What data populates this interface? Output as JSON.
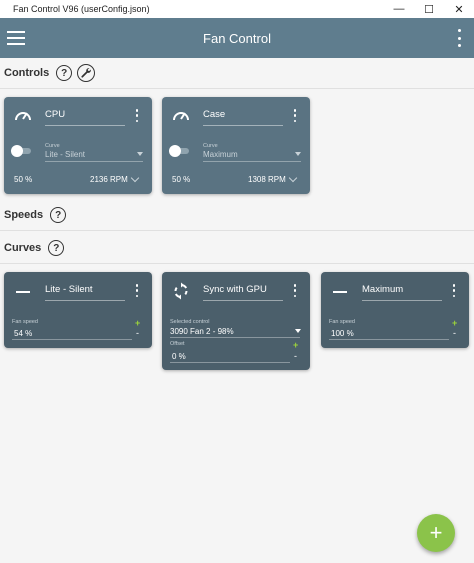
{
  "window": {
    "title": "Fan Control V96 (userConfig.json)",
    "minimize_glyph": "—",
    "maximize_glyph": "☐",
    "close_glyph": "✕"
  },
  "appbar": {
    "title": "Fan Control"
  },
  "sections": {
    "controls": "Controls",
    "speeds": "Speeds",
    "curves": "Curves",
    "help_glyph": "?"
  },
  "controls": [
    {
      "name": "CPU",
      "icon": "gauge-icon",
      "curve_label": "Curve",
      "curve_value": "Lite - Silent",
      "percent": "50 %",
      "rpm": "2136 RPM"
    },
    {
      "name": "Case",
      "icon": "gauge-icon",
      "curve_label": "Curve",
      "curve_value": "Maximum",
      "percent": "50 %",
      "rpm": "1308 RPM"
    }
  ],
  "curves": [
    {
      "name": "Lite - Silent",
      "icon": "dash-icon",
      "field_label": "Fan speed",
      "field_value": "54 %"
    },
    {
      "name": "Sync with GPU",
      "icon": "sync-icon",
      "selected_label": "Selected control",
      "selected_value": "3090 Fan 2 - 98%",
      "offset_label": "Offset",
      "offset_value": "0 %"
    },
    {
      "name": "Maximum",
      "icon": "dash-icon",
      "field_label": "Fan speed",
      "field_value": "100 %"
    }
  ],
  "stepper": {
    "plus": "+",
    "minus": "-"
  },
  "fab": {
    "glyph": "+"
  },
  "colors": {
    "appbar": "#5f7d8e",
    "control_card": "#5a7382",
    "curve_card": "#4b5f6b",
    "accent_green": "#8bc34a",
    "background": "#f5f5f5"
  }
}
